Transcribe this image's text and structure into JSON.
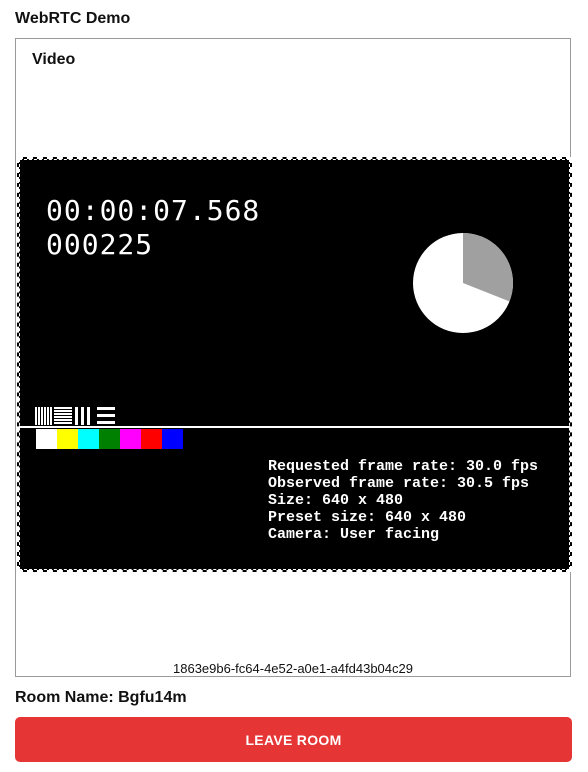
{
  "app": {
    "title": "WebRTC Demo"
  },
  "video_card": {
    "title": "Video",
    "participant_id": "1863e9b6-fc64-4e52-a0e1-a4fd43b04c29"
  },
  "test_pattern": {
    "timecode": "00:00:07.568",
    "frame_count": "000225",
    "pie_fraction": 0.31,
    "color_bars": [
      "#ffffff",
      "#ffff00",
      "#00ffff",
      "#008000",
      "#ff00ff",
      "#ff0000",
      "#0000ff"
    ],
    "info_lines": [
      "Requested frame rate: 30.0 fps",
      "Observed frame rate: 30.5 fps",
      "Size: 640 x 480",
      "Preset size: 640 x 480",
      "Camera: User facing"
    ]
  },
  "room": {
    "label": "Room Name: Bgfu14m",
    "leave_button_label": "LEAVE ROOM",
    "leave_button_color": "#e63535"
  }
}
